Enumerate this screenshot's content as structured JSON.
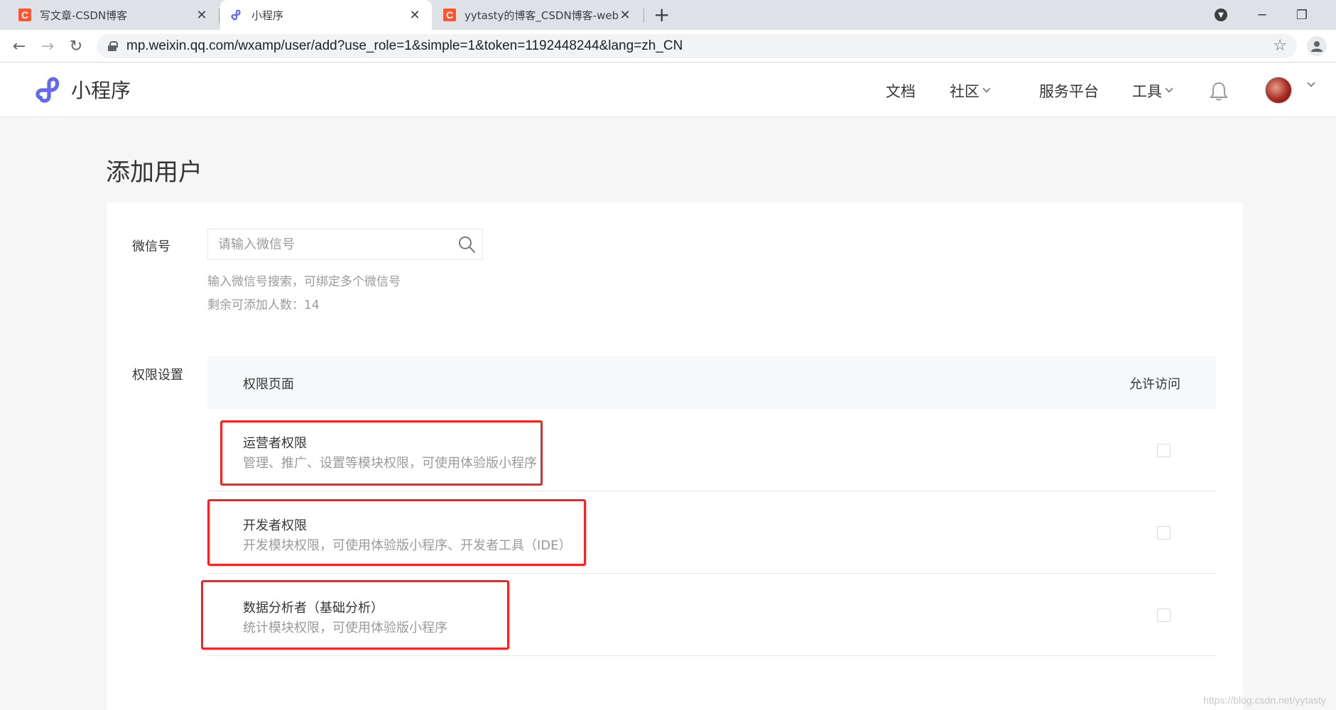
{
  "browser": {
    "tabs": [
      {
        "title": "写文章-CSDN博客",
        "favicon": "csdn-icon",
        "active": false
      },
      {
        "title": "小程序",
        "favicon": "miniprogram-icon",
        "active": true
      },
      {
        "title": "yytasty的博客_CSDN博客-web",
        "favicon": "csdn-icon",
        "active": false
      }
    ],
    "new_tab": "+",
    "url": "mp.weixin.qq.com/wxamp/user/add?use_role=1&simple=1&token=1192448244&lang=zh_CN"
  },
  "header": {
    "logo_text": "小程序",
    "nav": [
      {
        "label": "文档",
        "dropdown": false
      },
      {
        "label": "社区",
        "dropdown": true
      },
      {
        "label": "服务平台",
        "dropdown": false
      },
      {
        "label": "工具",
        "dropdown": true
      }
    ]
  },
  "page": {
    "title": "添加用户",
    "wechat": {
      "label": "微信号",
      "placeholder": "请输入微信号",
      "hint": "输入微信号搜索，可绑定多个微信号",
      "remaining": "剩余可添加人数：14"
    },
    "permissions": {
      "label": "权限设置",
      "col_page": "权限页面",
      "col_allow": "允许访问",
      "rows": [
        {
          "name": "运营者权限",
          "desc": "管理、推广、设置等模块权限，可使用体验版小程序",
          "checked": false
        },
        {
          "name": "开发者权限",
          "desc": "开发模块权限，可使用体验版小程序、开发者工具（IDE）",
          "checked": false
        },
        {
          "name": "数据分析者（基础分析）",
          "desc": "统计模块权限，可使用体验版小程序",
          "checked": false
        }
      ]
    }
  },
  "watermark": "https://blog.csdn.net/yytasty",
  "colors": {
    "brand": "#6467f0",
    "highlight": "#ff1f1f",
    "csdn": "#fc5531"
  }
}
